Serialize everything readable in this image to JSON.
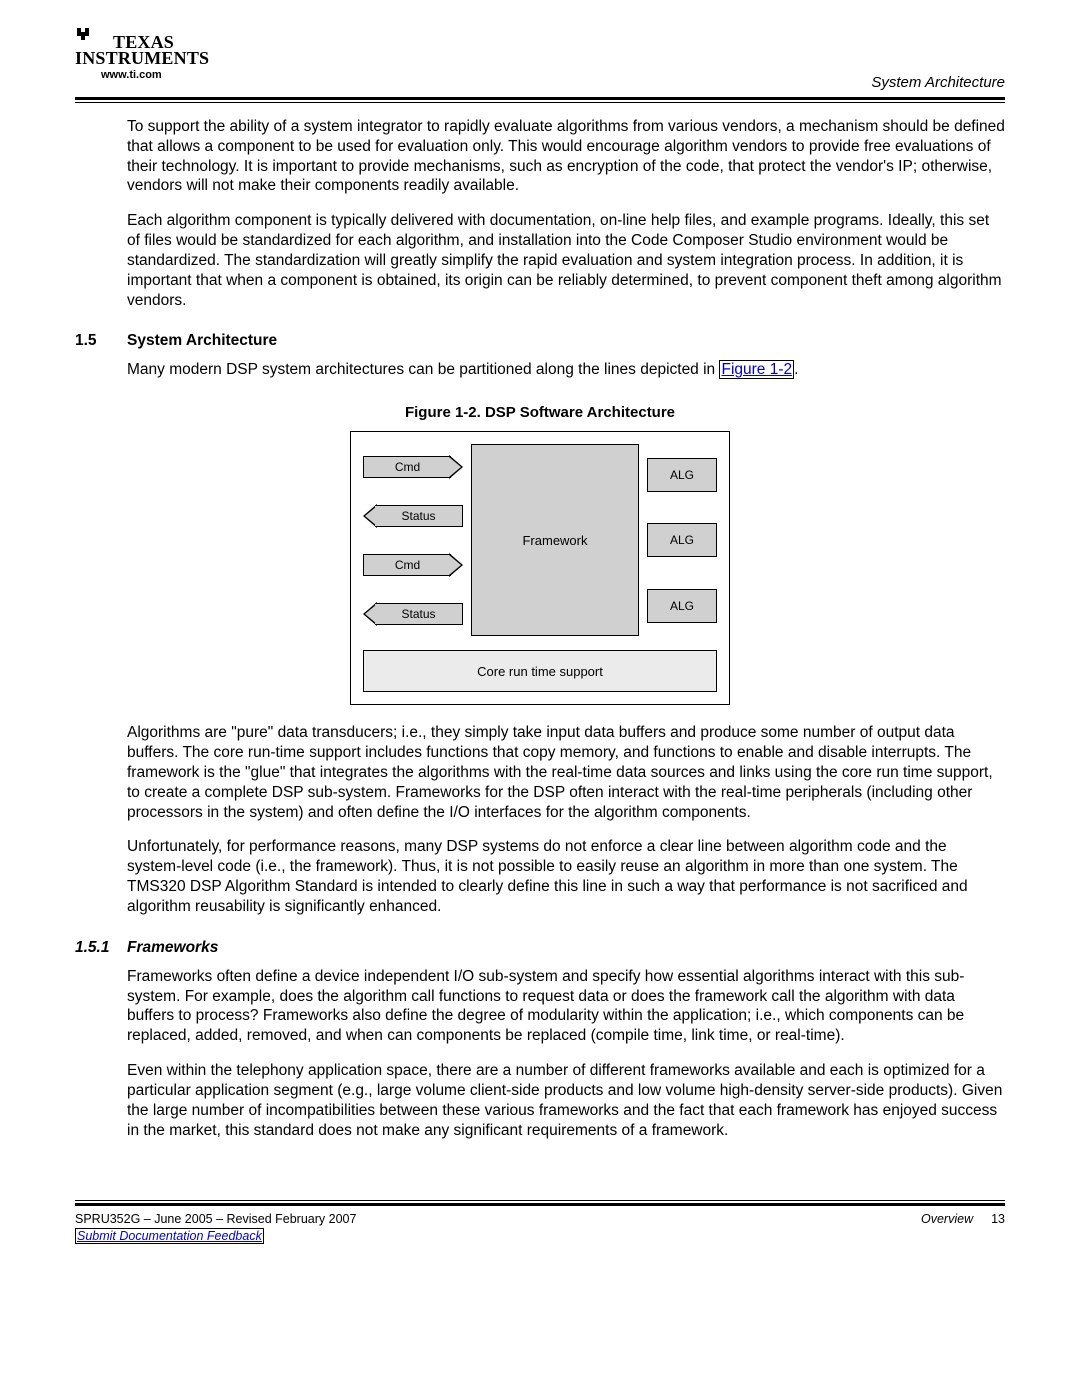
{
  "header": {
    "logo_line1": "TEXAS",
    "logo_line2": "INSTRUMENTS",
    "url": "www.ti.com",
    "right_label": "System Architecture"
  },
  "paragraphs": {
    "p1": "To support the ability of a system integrator to rapidly evaluate algorithms from various vendors, a mechanism should be defined that allows a component to be used for evaluation only. This would encourage algorithm vendors to provide free evaluations of their technology. It is important to provide mechanisms, such as encryption of the code, that protect the vendor's IP; otherwise, vendors will not make their components readily available.",
    "p2": "Each algorithm component is typically delivered with documentation, on-line help files, and example programs. Ideally, this set of files would be standardized for each algorithm, and installation into the Code Composer Studio environment would be standardized. The standardization will greatly simplify the rapid evaluation and system integration process. In addition, it is important that when a component is obtained, its origin can be reliably determined, to prevent component theft among algorithm vendors.",
    "p3_pre": "Many modern DSP system architectures can be partitioned along the lines depicted in ",
    "p3_link": "Figure 1-2",
    "p3_post": ".",
    "p4": "Algorithms are \"pure\" data transducers; i.e., they simply take input data buffers and produce some number of output data buffers. The core run-time support includes functions that copy memory, and functions to enable and disable interrupts. The framework is the \"glue\" that integrates the algorithms with the real-time data sources and links using the core run time support, to create a complete DSP sub-system. Frameworks for the DSP often interact with the real-time peripherals (including other processors in the system) and often define the I/O interfaces for the algorithm components.",
    "p5": "Unfortunately, for performance reasons, many DSP systems do not enforce a clear line between algorithm code and the system-level code (i.e., the framework). Thus, it is not possible to easily reuse an algorithm in more than one system. The TMS320 DSP Algorithm Standard is intended to clearly define this line in such a way that performance is not sacrificed and algorithm reusability is significantly enhanced.",
    "p6": "Frameworks often define a device independent I/O sub-system and specify how essential algorithms interact with this sub-system. For example, does the algorithm call functions to request data or does the framework call the algorithm with data buffers to process? Frameworks also define the degree of modularity within the application; i.e., which components can be replaced, added, removed, and when can components be replaced (compile time, link time, or real-time).",
    "p7": "Even within the telephony application space, there are a number of different frameworks available and each is optimized for a particular application segment (e.g., large volume client-side products and low volume high-density server-side products). Given the large number of incompatibilities between these various frameworks and the fact that each framework has enjoyed success in the market, this standard does not make any significant requirements of a framework."
  },
  "sections": {
    "s15_num": "1.5",
    "s15_title": "System Architecture",
    "s151_num": "1.5.1",
    "s151_title": "Frameworks"
  },
  "figure": {
    "caption": "Figure 1-2. DSP Software Architecture",
    "cmd": "Cmd",
    "status": "Status",
    "framework": "Framework",
    "alg": "ALG",
    "core": "Core run time support"
  },
  "footer": {
    "left": "SPRU352G – June 2005 – Revised February 2007",
    "feedback": "Submit Documentation Feedback",
    "overview": "Overview",
    "pagenum": "13"
  }
}
